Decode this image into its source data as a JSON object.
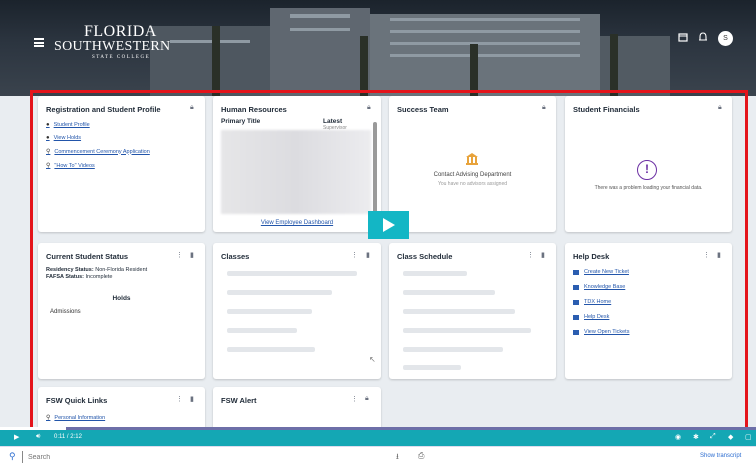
{
  "header": {
    "logo_line1": "FLORIDA",
    "logo_line2": "SOUTHWESTERN",
    "logo_line3": "STATE COLLEGE",
    "avatar_initial": "S",
    "icons": [
      "menu-icon",
      "calendar-icon",
      "bell-icon",
      "user-avatar"
    ]
  },
  "cards": {
    "registration": {
      "title": "Registration and Student Profile",
      "links": [
        "Student Profile",
        "View Holds",
        "Commencement Ceremony Application",
        "\"How To\" Videos"
      ],
      "link_icons": [
        "user-icon",
        "user-icon",
        "link-icon",
        "link-icon"
      ]
    },
    "hr": {
      "title": "Human Resources",
      "col1": "Primary Title",
      "col2": "Latest",
      "col2b": "Supervisor",
      "link": "View Employee Dashboard"
    },
    "success": {
      "title": "Success Team",
      "heading": "Contact Advising Department",
      "message": "You have no advisors assigned"
    },
    "financials": {
      "title": "Student Financials",
      "message": "There was a problem loading your financial data."
    },
    "status": {
      "title": "Current Student Status",
      "residency_label": "Residency Status:",
      "residency_value": "Non-Florida Resident",
      "fafsa_label": "FAFSA Status:",
      "fafsa_value": "Incomplete",
      "holds_heading": "Holds",
      "holds_item": "Admissions"
    },
    "classes": {
      "title": "Classes"
    },
    "schedule": {
      "title": "Class Schedule"
    },
    "helpdesk": {
      "title": "Help Desk",
      "links": [
        "Create New Ticket",
        "Knowledge Base",
        "TDX Home",
        "Help Desk",
        "View Open Tickets"
      ]
    },
    "quicklinks": {
      "title": "FSW Quick Links",
      "links": [
        "Personal Information"
      ]
    },
    "alert": {
      "title": "FSW Alert"
    }
  },
  "video": {
    "time": "0:11 / 2:12",
    "progress": 0.083
  },
  "footer": {
    "search_placeholder": "Search",
    "show_transcript": "Show transcript"
  },
  "colors": {
    "highlight": "#e4141b",
    "player": "#14a7b4",
    "link": "#2255aa"
  }
}
